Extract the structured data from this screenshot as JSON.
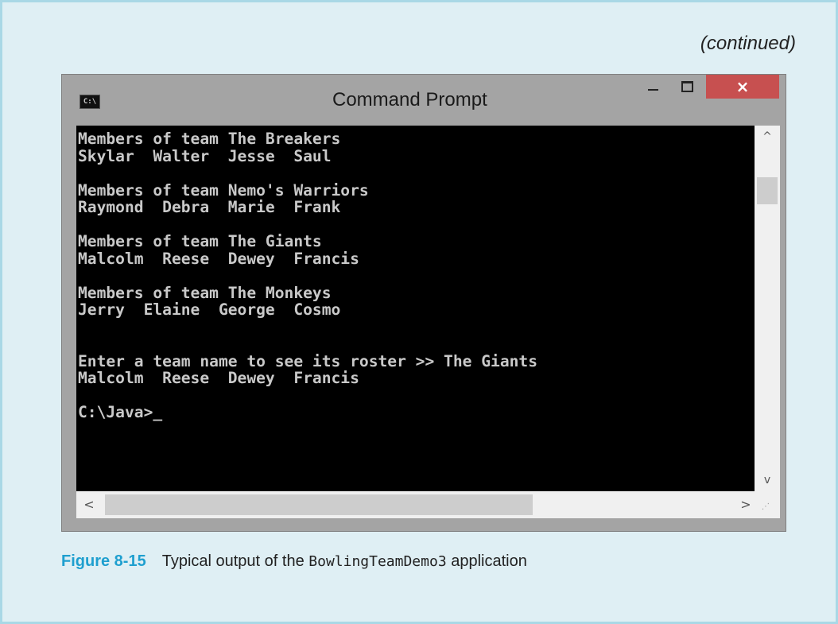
{
  "continued_label": "(continued)",
  "window": {
    "title": "Command Prompt",
    "icon_text": "C:\\",
    "icons": {
      "app": "console-app-icon",
      "minimize": "minimize-icon",
      "maximize": "maximize-icon",
      "close": "close-icon"
    },
    "close_glyph": "×"
  },
  "console": {
    "output": "Members of team The Breakers\nSkylar  Walter  Jesse  Saul\n\nMembers of team Nemo's Warriors\nRaymond  Debra  Marie  Frank\n\nMembers of team The Giants\nMalcolm  Reese  Dewey  Francis\n\nMembers of team The Monkeys\nJerry  Elaine  George  Cosmo\n\n\nEnter a team name to see its roster >> The Giants\nMalcolm  Reese  Dewey  Francis\n\nC:\\Java>_"
  },
  "scrollbars": {
    "up_glyph": "^",
    "down_glyph": "v",
    "left_glyph": "<",
    "right_glyph": ">",
    "grip_glyph": "⋰"
  },
  "caption": {
    "figure_number": "Figure 8-15",
    "text_before": "Typical output of the ",
    "code": "BowlingTeamDemo3",
    "text_after": " application"
  },
  "colors": {
    "panel_bg": "#dfeff4",
    "panel_border": "#a9d8e6",
    "figure_accent": "#1e9fcf",
    "close_button": "#c75050",
    "console_bg": "#000000",
    "console_text": "#c9c9c9"
  }
}
